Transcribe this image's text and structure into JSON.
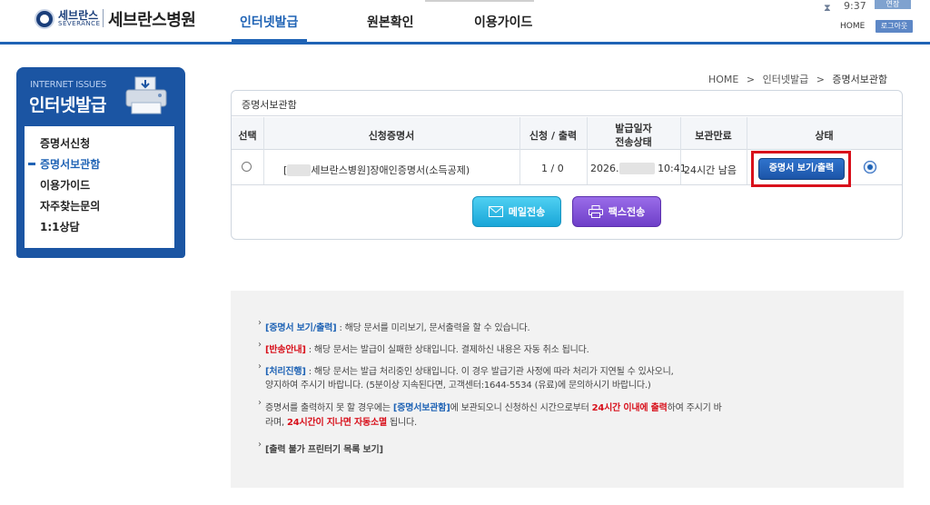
{
  "header": {
    "logo_kor": "세브란스",
    "logo_eng": "SEVERANCE",
    "hospital_name": "세브란스병원",
    "nav": [
      "인터넷발급",
      "원본확인",
      "이용가이드"
    ],
    "timer": "9:37",
    "extend_label": "연장",
    "home_label": "HOME",
    "logout_label": "로그아웃"
  },
  "sidebar": {
    "head_en": "INTERNET ISSUES",
    "head_ko": "인터넷발급",
    "items": [
      "증명서신청",
      "증명서보관함",
      "이용가이드",
      "자주찾는문의",
      "1:1상담"
    ]
  },
  "breadcrumb": [
    "HOME",
    ">",
    "인터넷발급",
    ">",
    "증명서보관함"
  ],
  "panel": {
    "title": "증명서보관함",
    "columns": [
      "선택",
      "신청증명서",
      "신청 / 출력",
      "발급일자",
      "전송상태",
      "보관만료",
      "상태"
    ],
    "row": {
      "cert_prefix": "[",
      "cert_name": "세브란스병원]장애인증명서(소득공제)",
      "count": "1 / 0",
      "date_prefix": "2026.",
      "time": "10:41",
      "expire": "24시간 남음",
      "view_button": "증명서 보기/출력"
    },
    "mail_button": "메일전송",
    "fax_button": "팩스전송"
  },
  "info": {
    "l1_tag": "[증명서 보기/출력]",
    "l1_text": " : 해당 문서를 미리보기, 문서출력을 할 수 있습니다.",
    "l2_tag": "[반송안내]",
    "l2_text": " : 해당 문서는 발급이 실패한 상태입니다. 결제하신 내용은 자동 취소 됩니다.",
    "l3_tag": "[처리진행]",
    "l3_text": " : 해당 문서는 발급 처리중인 상태입니다. 이 경우 발급기관 사정에 따라 처리가 지연될 수 있사오니,",
    "l3b": "양지하여 주시기 바랍니다. (5분이상 지속된다면, 고객센터:1644-5534 (유료)에 문의하시기 바랍니다.)",
    "l4_a": "증명서를 출력하지 못 할 경우에는 ",
    "l4_tag": "[증명서보관함]",
    "l4_b": "에 보관되오니 신청하신 시간으로부터 ",
    "l4_red": "24시간 이내에 출력",
    "l4_c": "하여 주시기 바",
    "l5_a": "라며, ",
    "l5_red": "24시간이 지나면 자동소멸",
    "l5_b": " 됩니다.",
    "l6": "[출력 불가 프린터기 목록 보기]"
  }
}
